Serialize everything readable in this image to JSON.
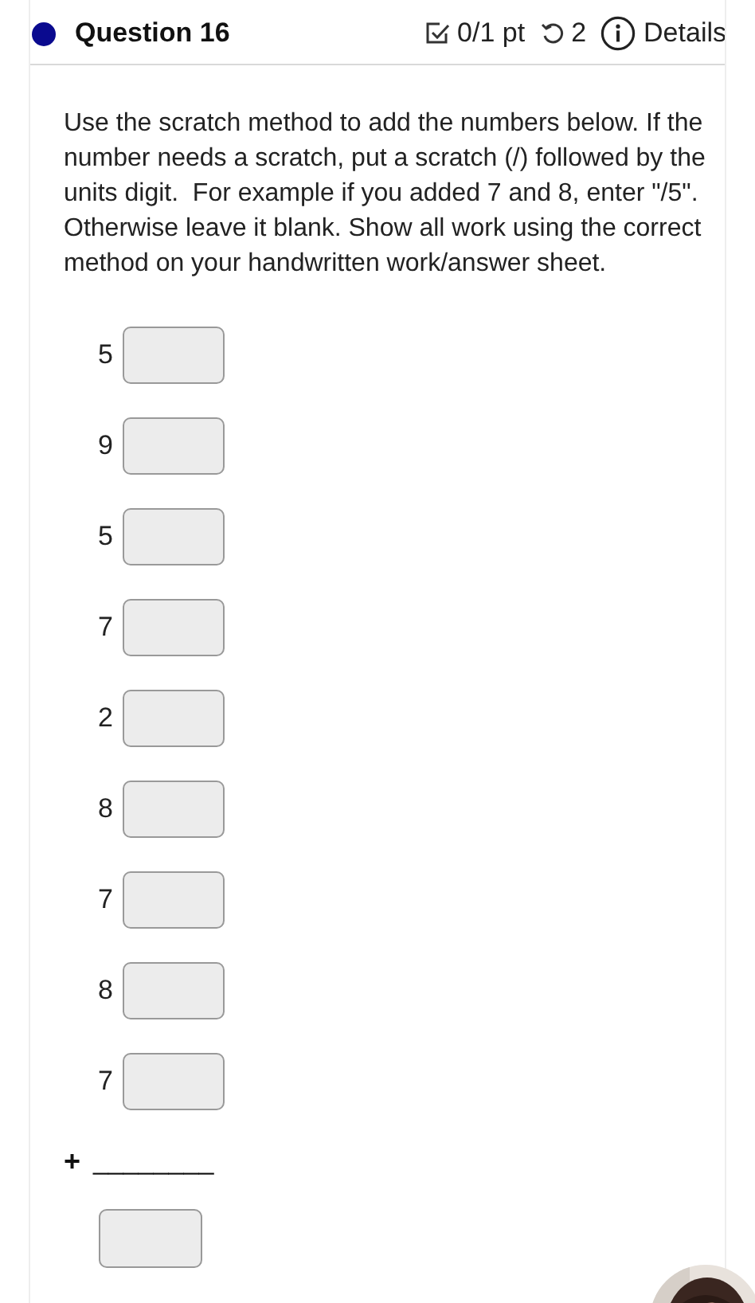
{
  "header": {
    "title": "Question 16",
    "score": "0/1 pt",
    "attempts": "2",
    "details": "Details"
  },
  "instructions": "Use the scratch method to add the numbers below. If the number needs a scratch, put a scratch (/) followed by the units digit.  For example if you added 7 and 8, enter \"/5\". Otherwise leave it blank. Show all work using the correct method on your handwritten work/answer sheet.",
  "rows": [
    {
      "digit": "5"
    },
    {
      "digit": "9"
    },
    {
      "digit": "5"
    },
    {
      "digit": "7"
    },
    {
      "digit": "2"
    },
    {
      "digit": "8"
    },
    {
      "digit": "7"
    },
    {
      "digit": "8"
    },
    {
      "digit": "7"
    }
  ],
  "sum": {
    "operator": "+",
    "line": "________"
  }
}
